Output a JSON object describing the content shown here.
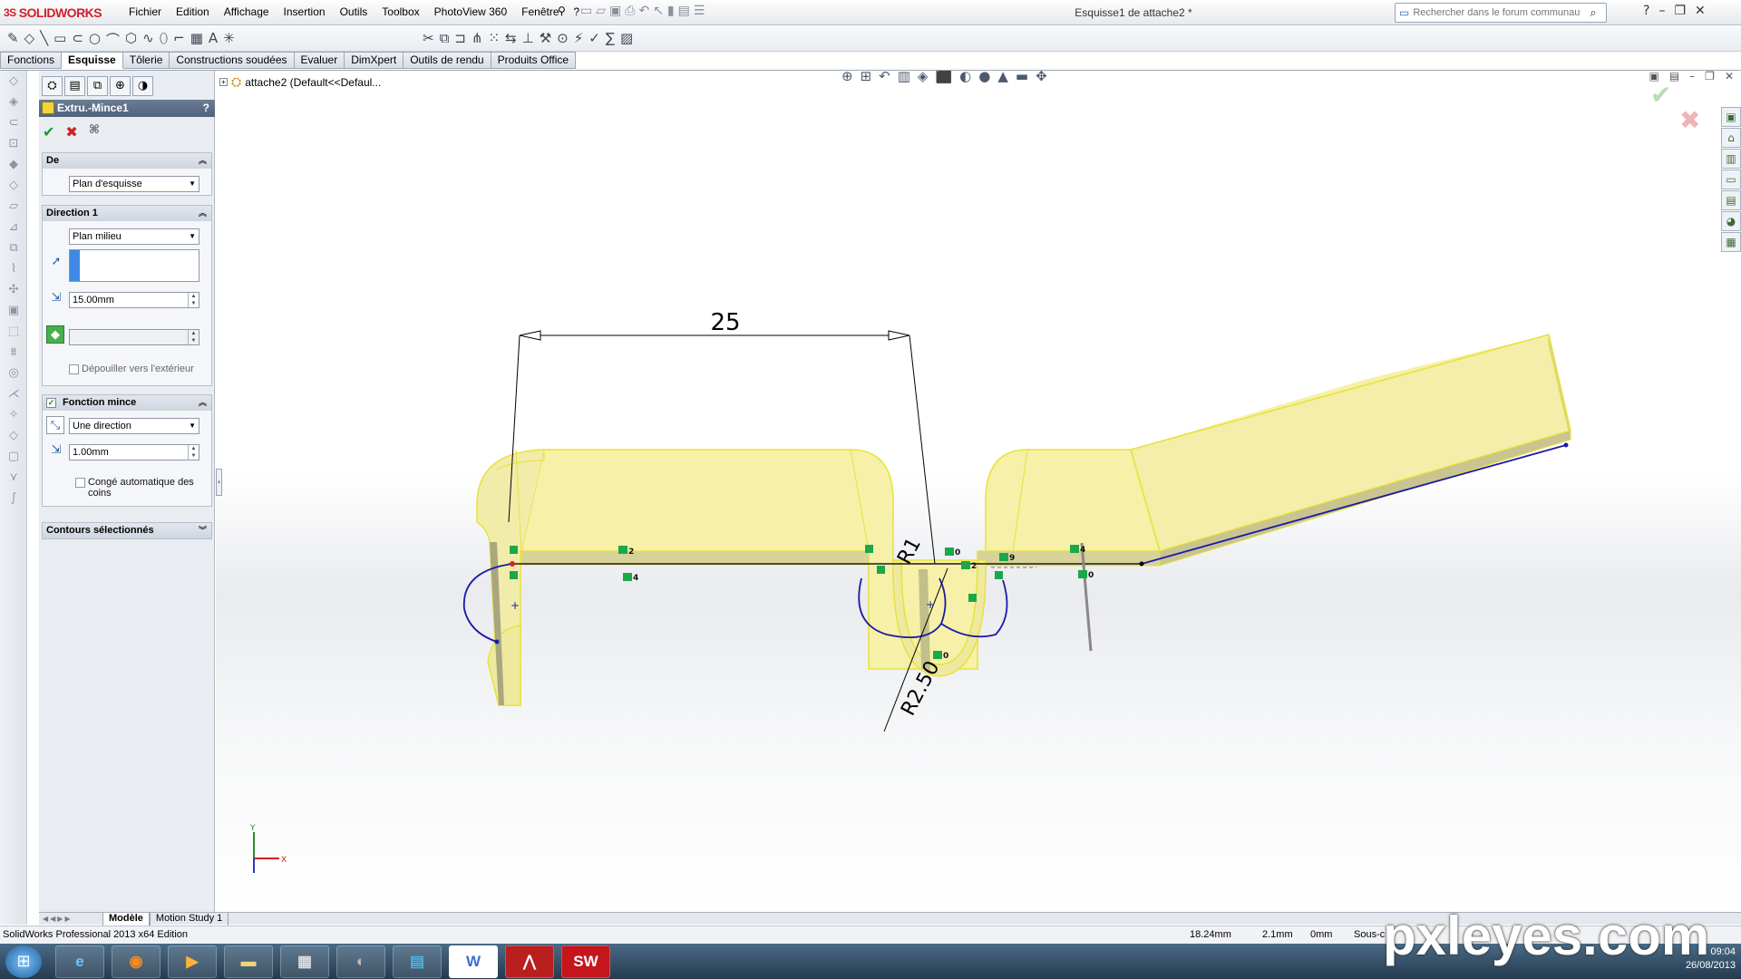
{
  "app": {
    "logo_ds": "3S",
    "logo_text": "SOLIDWORKS",
    "document_title": "Esquisse1 de attache2 *"
  },
  "menu": [
    "Fichier",
    "Edition",
    "Affichage",
    "Insertion",
    "Outils",
    "Toolbox",
    "PhotoView 360",
    "Fenêtre",
    "?"
  ],
  "search": {
    "placeholder": "Rechercher dans le forum communautaire"
  },
  "tabs": [
    "Fonctions",
    "Esquisse",
    "Tôlerie",
    "Constructions soudées",
    "Evaluer",
    "DimXpert",
    "Outils de rendu",
    "Produits Office"
  ],
  "active_tab": "Esquisse",
  "property_manager": {
    "title": "Extru.-Mince1",
    "help": "?",
    "sections": {
      "de": {
        "label": "De",
        "start_condition": "Plan d'esquisse"
      },
      "direction1": {
        "label": "Direction 1",
        "end_condition": "Plan milieu",
        "depth": "15.00mm",
        "draft_label": "Dépouiller vers l'extérieur"
      },
      "thin_feature": {
        "label": "Fonction mince",
        "type": "Une direction",
        "thickness": "1.00mm",
        "auto_fillet_label": "Congé automatique des coins"
      },
      "selected_contours": {
        "label": "Contours sélectionnés"
      }
    }
  },
  "tree": {
    "label": "attache2  (Default<<Defaul..."
  },
  "sketch": {
    "dimension_width": "25",
    "radius_1": "R1",
    "radius_2": "R2.50",
    "relation_labels": [
      "2",
      "4",
      "0",
      "2",
      "9",
      "4",
      "0",
      "0"
    ],
    "axis_y": "Y",
    "axis_x": "X",
    "colors": {
      "body_fill": "#f6f0a8",
      "body_edge": "#e8e23a",
      "sketch_line": "#1a1aa8",
      "relation": "#1aa84a"
    }
  },
  "bottom_tabs": [
    "Modèle",
    "Motion Study 1"
  ],
  "status": {
    "product": "SolidWorks Professional 2013 x64 Edition",
    "x": "18.24mm",
    "y": "2.1mm",
    "z": "0mm",
    "mode": "Sous-c"
  },
  "taskbar": {
    "time": "09:04",
    "date": "26/08/2013"
  },
  "watermark": "pxleyes.com"
}
